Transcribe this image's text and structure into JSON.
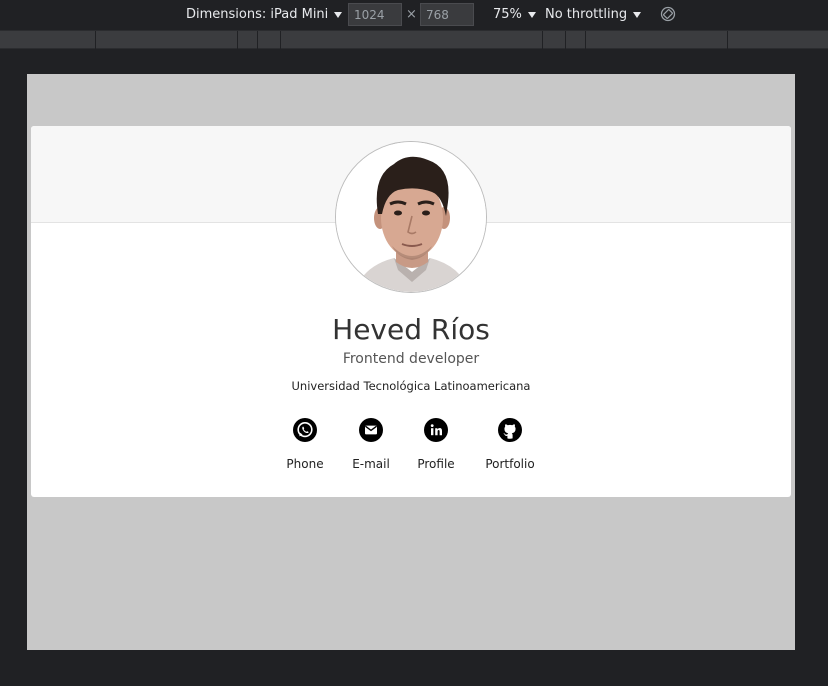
{
  "toolbar": {
    "dimensions_label": "Dimensions: iPad Mini",
    "width": "1024",
    "height": "768",
    "times": "×",
    "zoom": "75%",
    "throttling": "No throttling"
  },
  "profile": {
    "name": "Heved Ríos",
    "role": "Frontend developer",
    "organization": "Universidad Tecnológica Latinoamericana",
    "links": [
      {
        "label": "Phone",
        "icon": "whatsapp-icon"
      },
      {
        "label": "E-mail",
        "icon": "email-icon"
      },
      {
        "label": "Profile",
        "icon": "linkedin-icon"
      },
      {
        "label": "Portfolio",
        "icon": "github-icon"
      }
    ]
  },
  "colors": {
    "devtools_bg": "#202124",
    "viewport_bg": "#c8c8c8",
    "card_header_bg": "#f7f7f7",
    "icon": "#000000"
  }
}
